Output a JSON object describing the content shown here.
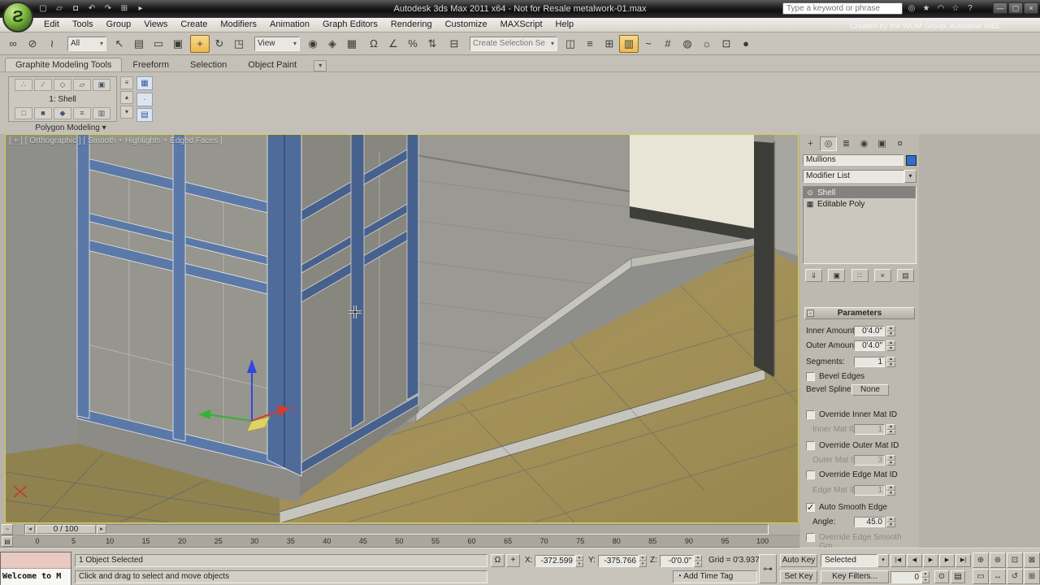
{
  "titlebar": {
    "title": "Autodesk 3ds Max  2011 x64  - Not for Resale    metalwork-01.max",
    "search_placeholder": "Type a keyword or phrase",
    "quick_access": [
      {
        "name": "new-scene-button",
        "glyph": "▢"
      },
      {
        "name": "open-file-button",
        "glyph": "▱"
      },
      {
        "name": "save-file-button",
        "glyph": "◘"
      },
      {
        "name": "undo-button",
        "glyph": "↶"
      },
      {
        "name": "redo-button",
        "glyph": "↷"
      },
      {
        "name": "project-folder-button",
        "glyph": "⊞"
      },
      {
        "name": "toolbar-overflow-button",
        "glyph": "▸"
      }
    ],
    "info_icons": [
      {
        "name": "search-go-icon",
        "glyph": "◎"
      },
      {
        "name": "subscription-center-icon",
        "glyph": "★"
      },
      {
        "name": "communication-center-icon",
        "glyph": "◠"
      },
      {
        "name": "favorites-icon",
        "glyph": "☆"
      },
      {
        "name": "help-icon",
        "glyph": "?"
      }
    ],
    "window_controls": [
      {
        "name": "minimize-button",
        "glyph": "—"
      },
      {
        "name": "maximize-button",
        "glyph": "▢"
      },
      {
        "name": "close-button",
        "glyph": "×"
      }
    ],
    "logo_glyph": "Ƨ"
  },
  "menubar": {
    "items": [
      "Edit",
      "Tools",
      "Group",
      "Views",
      "Create",
      "Modifiers",
      "Animation",
      "Graph Editors",
      "Rendering",
      "Customize",
      "MAXScript",
      "Help"
    ],
    "watermark": "Created by the WDM Group, Autodesk M&E"
  },
  "toolbar": {
    "seg1": [
      {
        "name": "select-and-link-button",
        "glyph": "∞"
      },
      {
        "name": "unlink-selection-button",
        "glyph": "⊘"
      },
      {
        "name": "bind-to-space-warp-button",
        "glyph": "≀"
      }
    ],
    "selection_filter": "All",
    "seg2": [
      {
        "name": "select-object-button",
        "glyph": "↖"
      },
      {
        "name": "select-by-name-button",
        "glyph": "▤"
      },
      {
        "name": "rectangular-selection-region-button",
        "glyph": "▭"
      },
      {
        "name": "window-crossing-toggle",
        "glyph": "▣"
      }
    ],
    "seg3": [
      {
        "name": "select-and-move-button",
        "glyph": "+",
        "active": true
      },
      {
        "name": "select-and-rotate-button",
        "glyph": "↻"
      },
      {
        "name": "select-and-scale-button",
        "glyph": "◳"
      }
    ],
    "coord_system": "View",
    "seg4": [
      {
        "name": "use-pivot-center-button",
        "glyph": "◉"
      },
      {
        "name": "select-and-manipulate-button",
        "glyph": "◈"
      },
      {
        "name": "keyboard-shortcut-override-toggle",
        "glyph": "▦"
      }
    ],
    "seg5": [
      {
        "name": "snap-toggle-3d",
        "glyph": "Ω"
      },
      {
        "name": "angle-snap-toggle",
        "glyph": "∠"
      },
      {
        "name": "percent-snap-toggle",
        "glyph": "%"
      },
      {
        "name": "spinner-snap-toggle",
        "glyph": "⇅"
      }
    ],
    "seg6": [
      {
        "name": "edit-named-selection-sets-button",
        "glyph": "⊟"
      }
    ],
    "named_selection": "Create Selection Se",
    "seg7": [
      {
        "name": "mirror-button",
        "glyph": "◫"
      },
      {
        "name": "align-button",
        "glyph": "≡"
      },
      {
        "name": "layer-manager-button",
        "glyph": "⊞"
      },
      {
        "name": "graphite-ribbon-toggle",
        "glyph": "▥",
        "active": true
      },
      {
        "name": "curve-editor-button",
        "glyph": "~"
      },
      {
        "name": "schematic-view-button",
        "glyph": "#"
      },
      {
        "name": "material-editor-button",
        "glyph": "◍"
      },
      {
        "name": "render-setup-button",
        "glyph": "☼"
      },
      {
        "name": "rendered-frame-window-button",
        "glyph": "⊡"
      },
      {
        "name": "render-production-button",
        "glyph": "●"
      }
    ]
  },
  "ribbon": {
    "tabs": [
      {
        "label": "Graphite Modeling Tools",
        "active": true,
        "name": "tab-graphite-modeling-tools"
      },
      {
        "label": "Freeform",
        "name": "tab-freeform"
      },
      {
        "label": "Selection",
        "name": "tab-selection"
      },
      {
        "label": "Object Paint",
        "name": "tab-object-paint"
      }
    ],
    "minimize_glyph": "▾",
    "panel_title": "Polygon Modeling",
    "panel_caret": "▾",
    "field_label": "1: Shell",
    "row1": [
      {
        "name": "vertex-mode-button",
        "glyph": "∴"
      },
      {
        "name": "edge-mode-button",
        "glyph": "∕"
      },
      {
        "name": "border-mode-button",
        "glyph": "◇"
      },
      {
        "name": "polygon-mode-button",
        "glyph": "▱"
      },
      {
        "name": "element-mode-button",
        "glyph": "▣"
      }
    ],
    "row2": [
      {
        "name": "preview-off-button",
        "glyph": "□"
      },
      {
        "name": "preview-subobj-button",
        "glyph": "■"
      },
      {
        "name": "preview-multi-button",
        "glyph": "◆"
      },
      {
        "name": "collapse-stack-button",
        "glyph": "≡"
      },
      {
        "name": "pin-stack-button-ribbon",
        "glyph": "▥"
      }
    ],
    "side_col": [
      {
        "name": "stack-tools-button",
        "glyph": "≡"
      },
      {
        "name": "expand-up-button",
        "glyph": "▴"
      },
      {
        "name": "expand-down-button",
        "glyph": "▾"
      }
    ],
    "blue_col": [
      {
        "name": "edit-poly-mode-button",
        "glyph": "▦"
      },
      {
        "name": "ribbon-mid-button",
        "glyph": "·"
      },
      {
        "name": "toggle-panel-button",
        "glyph": "▤"
      }
    ]
  },
  "viewport": {
    "label": "[ + ] [ Orthographic ] [ Smooth + Highlights + Edged Faces ]"
  },
  "command_panel": {
    "tabs": [
      {
        "name": "tab-create",
        "glyph": "+"
      },
      {
        "name": "tab-modify",
        "glyph": "◎",
        "active": true
      },
      {
        "name": "tab-hierarchy",
        "glyph": "≣"
      },
      {
        "name": "tab-motion",
        "glyph": "◉"
      },
      {
        "name": "tab-display",
        "glyph": "▣"
      },
      {
        "name": "tab-utilities",
        "glyph": "¤"
      }
    ],
    "object_name": "Mullions",
    "modifier_list_label": "Modifier List",
    "stack": [
      {
        "label": "Shell",
        "icon": "⊙",
        "selected": true,
        "name": "stack-item-shell"
      },
      {
        "label": "Editable Poly",
        "icon": "▦",
        "name": "stack-item-editable-poly"
      }
    ],
    "stack_buttons": [
      {
        "name": "pin-stack-button",
        "glyph": "⇓"
      },
      {
        "name": "show-end-result-button",
        "glyph": "▣"
      },
      {
        "name": "make-unique-button",
        "glyph": "∷"
      },
      {
        "name": "remove-modifier-button",
        "glyph": "×"
      },
      {
        "name": "configure-modifier-sets-button",
        "glyph": "▤"
      }
    ],
    "rollout_title": "Parameters",
    "rollout_collapse_glyph": "-",
    "params": {
      "inner_amount": {
        "label": "Inner Amount:",
        "value": "0'4.0\""
      },
      "outer_amount": {
        "label": "Outer Amount:",
        "value": "0'4.0\""
      },
      "segments": {
        "label": "Segments:",
        "value": "1"
      },
      "bevel_edges": {
        "label": "Bevel Edges",
        "checked": false
      },
      "bevel_spline": {
        "label": "Bevel Spline:",
        "button": "None"
      },
      "override_inner": {
        "label": "Override Inner Mat ID",
        "checked": false
      },
      "inner_mat": {
        "label": "Inner Mat ID:",
        "value": "1"
      },
      "override_outer": {
        "label": "Override Outer Mat ID",
        "checked": false
      },
      "outer_mat": {
        "label": "Outer Mat ID:",
        "value": "3"
      },
      "override_edge": {
        "label": "Override Edge Mat ID",
        "checked": false
      },
      "edge_mat": {
        "label": "Edge Mat ID:",
        "value": "1"
      },
      "auto_smooth": {
        "label": "Auto Smooth Edge",
        "checked": true
      },
      "angle": {
        "label": "Angle:",
        "value": "45.0"
      },
      "override_smooth": {
        "label": "Override Edge Smooth Grp",
        "checked": false
      }
    }
  },
  "timeline": {
    "slider_value": "0 / 100",
    "prev_glyph": "◂",
    "next_glyph": "▸",
    "mini_buttons": [
      {
        "name": "open-mini-curve-editor-button",
        "glyph": "~"
      },
      {
        "name": "timeline-config-button",
        "glyph": "▤"
      }
    ],
    "ticks": [
      "0",
      "5",
      "10",
      "15",
      "20",
      "25",
      "30",
      "35",
      "40",
      "45",
      "50",
      "55",
      "60",
      "65",
      "70",
      "75",
      "80",
      "85",
      "90",
      "95",
      "100"
    ]
  },
  "statusbar": {
    "selection_status": "1 Object Selected",
    "prompt": "Click and drag to select and move objects",
    "welcome_title": "Welcome to M",
    "lock_glyph": "Ω",
    "abs_mode_glyph": "+",
    "coords": {
      "x_label": "X:",
      "x": "-372.599",
      "y_label": "Y:",
      "y": "-375.766",
      "z_label": "Z:",
      "z": "-0'0.0\""
    },
    "grid": "Grid = 0'3.937\"",
    "add_time_tag": "Add Time Tag",
    "time_tag_glyph": "◔",
    "set_keys_glyph": "⊶",
    "auto_key": "Auto Key",
    "set_key": "Set Key",
    "key_mode": "Selected",
    "key_filters": "Key Filters...",
    "time_value": "0",
    "playback": [
      {
        "name": "go-to-start-button",
        "glyph": "|◀"
      },
      {
        "name": "previous-frame-button",
        "glyph": "◀"
      },
      {
        "name": "play-button",
        "glyph": "▶"
      },
      {
        "name": "next-frame-button",
        "glyph": "▶"
      },
      {
        "name": "go-to-end-button",
        "glyph": "▶|"
      }
    ],
    "extra_buttons": [
      {
        "name": "key-mode-toggle",
        "glyph": "⊙"
      },
      {
        "name": "time-configuration-button",
        "glyph": "▤"
      }
    ],
    "nav_buttons": [
      {
        "name": "zoom-button",
        "glyph": "⊕"
      },
      {
        "name": "zoom-all-button",
        "glyph": "⊛"
      },
      {
        "name": "zoom-extents-button",
        "glyph": "⊡"
      },
      {
        "name": "zoom-extents-all-button",
        "glyph": "⊠"
      },
      {
        "name": "field-of-view-button",
        "glyph": "▭"
      },
      {
        "name": "pan-button",
        "glyph": "↔"
      },
      {
        "name": "orbit-button",
        "glyph": "↺"
      },
      {
        "name": "maximize-viewport-toggle",
        "glyph": "⊞"
      }
    ]
  },
  "scene_colors": {
    "viewport_border": "#d8cf3c",
    "mullion_blue": "#5b79a8",
    "mullion_dark_blue": "#47618e",
    "floor_tan": "#a39158",
    "wall_gray": "#9a9994",
    "gizmo_x_red": "#d43b32",
    "gizmo_y_green": "#35b135",
    "gizmo_z_blue": "#3247e0",
    "gizmo_plane_yellow": "#e8e060"
  }
}
